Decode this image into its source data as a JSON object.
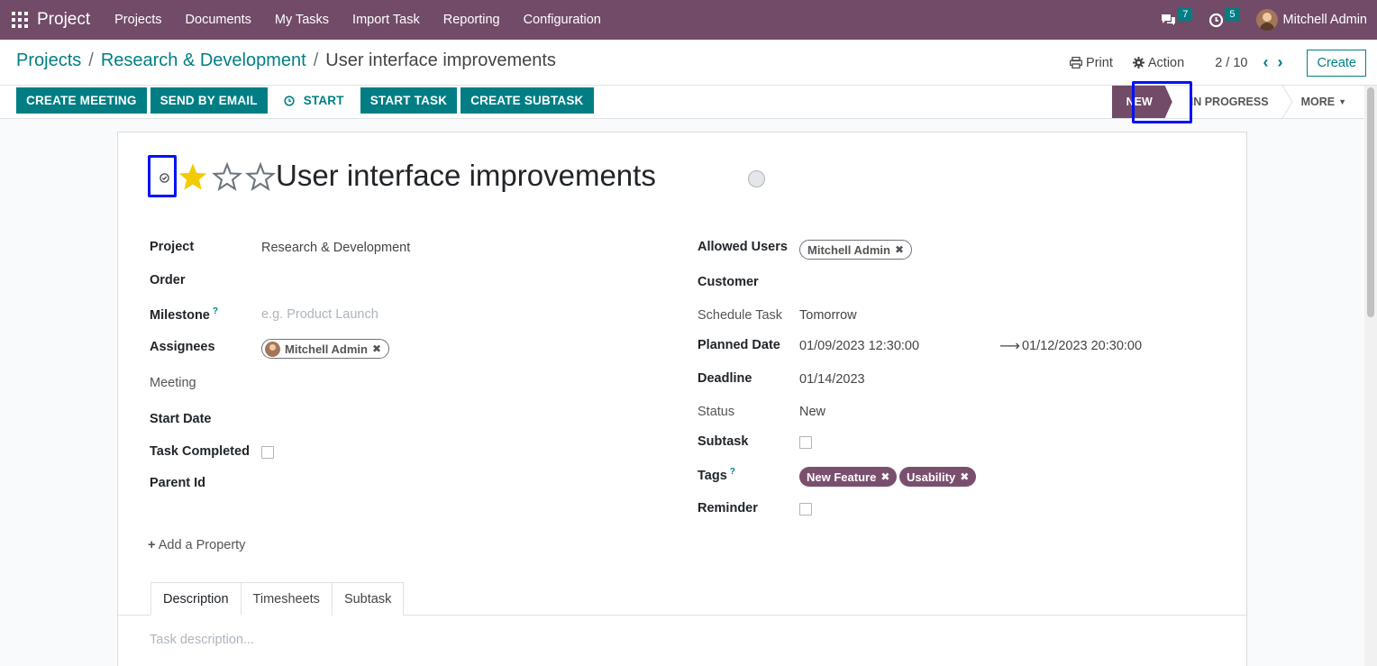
{
  "navbar": {
    "app_name": "Project",
    "menu": [
      "Projects",
      "Documents",
      "My Tasks",
      "Import Task",
      "Reporting",
      "Configuration"
    ],
    "messages_count": "7",
    "activities_count": "5",
    "user_name": "Mitchell Admin"
  },
  "breadcrumb": {
    "root": "Projects",
    "project": "Research & Development",
    "current": "User interface improvements"
  },
  "control": {
    "print_label": "Print",
    "action_label": "Action",
    "pager": "2 / 10",
    "create_label": "Create"
  },
  "statusbar": {
    "buttons": [
      "CREATE MEETING",
      "SEND BY EMAIL",
      "START",
      "START TASK",
      "CREATE SUBTASK"
    ],
    "stages": {
      "active": "NEW",
      "next": "IN PROGRESS",
      "more": "MORE"
    }
  },
  "task": {
    "title": "User interface improvements",
    "priority_stars": 1
  },
  "left_fields": {
    "project_label": "Project",
    "project_value": "Research & Development",
    "order_label": "Order",
    "milestone_label": "Milestone",
    "milestone_help": "?",
    "milestone_placeholder": "e.g. Product Launch",
    "assignees_label": "Assignees",
    "assignee": "Mitchell Admin",
    "meeting_label": "Meeting",
    "start_date_label": "Start Date",
    "task_completed_label": "Task Completed",
    "parent_id_label": "Parent Id"
  },
  "right_fields": {
    "allowed_users_label": "Allowed Users",
    "allowed_user": "Mitchell Admin",
    "customer_label": "Customer",
    "schedule_task_label": "Schedule Task",
    "schedule_task_value": "Tomorrow",
    "planned_date_label": "Planned Date",
    "planned_start": "01/09/2023 12:30:00",
    "planned_end": "01/12/2023 20:30:00",
    "deadline_label": "Deadline",
    "deadline_value": "01/14/2023",
    "status_label": "Status",
    "status_value": "New",
    "subtask_label": "Subtask",
    "tags_label": "Tags",
    "tags_help": "?",
    "tags": [
      "New Feature",
      "Usability"
    ],
    "reminder_label": "Reminder"
  },
  "add_property_label": "Add a Property",
  "tabs": [
    "Description",
    "Timesheets",
    "Subtask"
  ],
  "description_placeholder": "Task description...",
  "colors": {
    "brand": "#714b67",
    "accent": "#017e84",
    "highlight": "#0011ff"
  }
}
